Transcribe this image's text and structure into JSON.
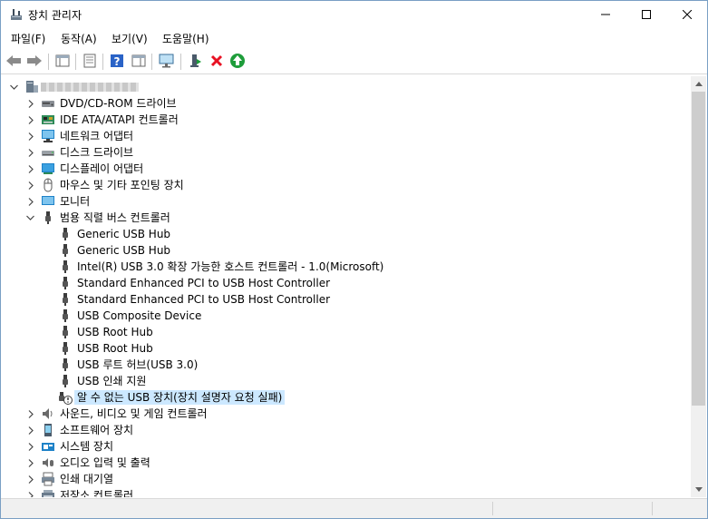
{
  "window": {
    "title": "장치 관리자"
  },
  "menu": [
    "파일(F)",
    "동작(A)",
    "보기(V)",
    "도움말(H)"
  ],
  "tree": {
    "root_label": "",
    "categories_before": [
      {
        "label": "DVD/CD-ROM 드라이브",
        "icon": "dvd-drive-icon"
      },
      {
        "label": "IDE ATA/ATAPI 컨트롤러",
        "icon": "ide-controller-icon"
      },
      {
        "label": "네트워크 어댑터",
        "icon": "network-adapter-icon"
      },
      {
        "label": "디스크 드라이브",
        "icon": "disk-drive-icon"
      },
      {
        "label": "디스플레이 어댑터",
        "icon": "display-adapter-icon"
      },
      {
        "label": "마우스 및 기타 포인팅 장치",
        "icon": "mouse-icon"
      },
      {
        "label": "모니터",
        "icon": "monitor-icon"
      }
    ],
    "expanded_category": {
      "label": "범용 직렬 버스 컨트롤러",
      "icon": "usb-icon"
    },
    "usb_devices": [
      "Generic USB Hub",
      "Generic USB Hub",
      "Intel(R) USB 3.0 확장 가능한 호스트 컨트롤러 - 1.0(Microsoft)",
      "Standard Enhanced PCI to USB Host Controller",
      "Standard Enhanced PCI to USB Host Controller",
      "USB Composite Device",
      "USB Root Hub",
      "USB Root Hub",
      "USB 루트 허브(USB 3.0)",
      "USB 인쇄 지원"
    ],
    "selected_device": "알 수 없는 USB 장치(장치 설명자 요청 실패)",
    "categories_after": [
      {
        "label": "사운드, 비디오 및 게임 컨트롤러",
        "icon": "sound-icon"
      },
      {
        "label": "소프트웨어 장치",
        "icon": "software-device-icon"
      },
      {
        "label": "시스템 장치",
        "icon": "system-device-icon"
      },
      {
        "label": "오디오 입력 및 출력",
        "icon": "audio-io-icon"
      },
      {
        "label": "인쇄 대기열",
        "icon": "print-queue-icon"
      },
      {
        "label": "저장소 컨트롤러",
        "icon": "storage-controller-icon"
      }
    ]
  },
  "colors": {
    "selection": "#cce8ff",
    "accent_green": "#1e9d3a",
    "uninstall_red": "#e81123",
    "help_blue": "#2a63c7"
  }
}
